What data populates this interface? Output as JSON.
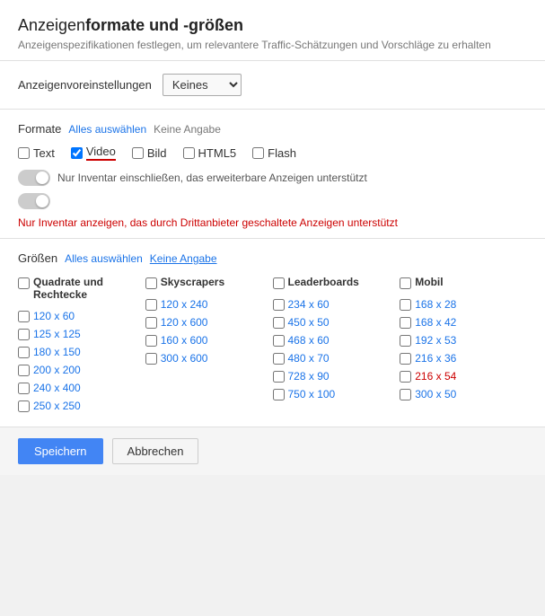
{
  "header": {
    "title_normal": "Anzeigen",
    "title_bold": "formate und -größen",
    "subtitle": "Anzeigenspezifikationen festlegen, um relevantere Traffic-Schätzungen und Vorschläge zu erhalten"
  },
  "anzeigenvoreinstellungen": {
    "label": "Anzeigenvoreinstellungen",
    "dropdown_value": "Keines",
    "dropdown_options": [
      "Keines"
    ]
  },
  "formate": {
    "title": "Formate",
    "select_all": "Alles auswählen",
    "no_entry": "Keine Angabe",
    "checkboxes": [
      {
        "id": "cb-text",
        "label": "Text",
        "checked": false
      },
      {
        "id": "cb-video",
        "label": "Video",
        "checked": true,
        "underline": true
      },
      {
        "id": "cb-bild",
        "label": "Bild",
        "checked": false
      },
      {
        "id": "cb-html5",
        "label": "HTML5",
        "checked": false
      },
      {
        "id": "cb-flash",
        "label": "Flash",
        "checked": false
      }
    ],
    "toggle1_text": "Nur Inventar einschließen, das erweiterbare Anzeigen unterstützt",
    "toggle2_text": "",
    "red_text": "Nur Inventar anzeigen, das durch Drittanbieter geschaltete Anzeigen unterstützt"
  },
  "grossen": {
    "title": "Größen",
    "select_all": "Alles auswählen",
    "no_entry": "Keine Angabe",
    "columns": [
      {
        "header": "Quadrate und Rechtecke",
        "sizes": [
          "120 x 60",
          "125 x 125",
          "180 x 150",
          "200 x 200",
          "240 x 400",
          "250 x 250"
        ]
      },
      {
        "header": "Skyscrapers",
        "sizes": [
          "120 x 240",
          "120 x 600",
          "160 x 600",
          "300 x 600"
        ]
      },
      {
        "header": "Leaderboards",
        "sizes": [
          "234 x 60",
          "450 x 50",
          "468 x 60",
          "480 x 70",
          "728 x 90",
          "750 x 100"
        ]
      },
      {
        "header": "Mobil",
        "sizes": [
          "168 x 28",
          "168 x 42",
          "192 x 53",
          "216 x 36",
          "216 x 54",
          "300 x 50"
        ]
      }
    ]
  },
  "footer": {
    "save_label": "Speichern",
    "cancel_label": "Abbrechen"
  }
}
